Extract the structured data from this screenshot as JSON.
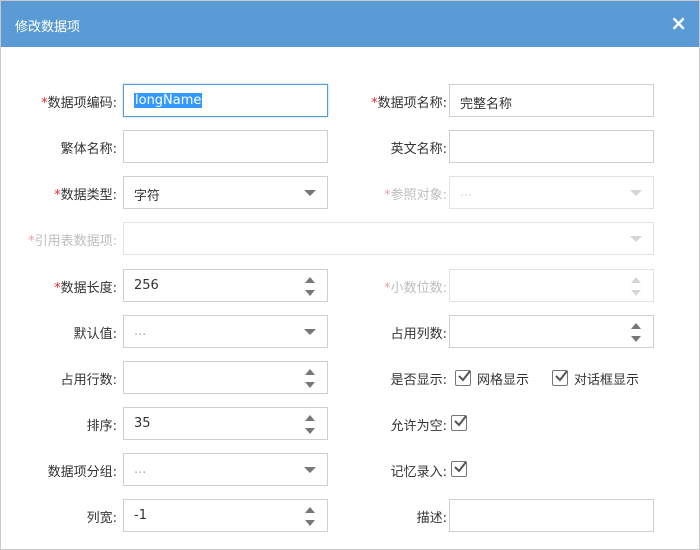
{
  "dialog": {
    "title": "修改数据项",
    "close_icon": "×"
  },
  "labels": {
    "code": "数据项编码:",
    "name": "数据项名称:",
    "trad_name": "繁体名称:",
    "en_name": "英文名称:",
    "data_type": "数据类型:",
    "ref_obj": "参照对象:",
    "ref_table": "引用表数据项:",
    "length": "数据长度:",
    "decimals": "小数位数:",
    "default": "默认值:",
    "col_span": "占用列数:",
    "row_span": "占用行数:",
    "visible": "是否显示:",
    "order": "排序:",
    "nullable": "允许为空:",
    "group": "数据项分组:",
    "remember": "记忆录入:",
    "col_width": "列宽:",
    "desc": "描述:"
  },
  "required_mark": "*",
  "values": {
    "code": "longName",
    "name": "完整名称",
    "trad_name": "",
    "en_name": "",
    "data_type": "字符",
    "ref_obj_placeholder": "...",
    "ref_table": "",
    "length": "256",
    "decimals": "",
    "default_placeholder": "...",
    "col_span": "",
    "row_span": "",
    "order": "35",
    "group_placeholder": "...",
    "col_width": "-1",
    "desc": ""
  },
  "checkboxes": {
    "grid_display": {
      "label": "网格显示",
      "checked": true
    },
    "dialog_display": {
      "label": "对话框显示",
      "checked": true
    },
    "nullable": {
      "checked": true
    },
    "remember": {
      "checked": true
    }
  },
  "colors": {
    "title_bar": "#5b9bd5",
    "required": "#e52727",
    "focus_border": "#5b9bd5"
  }
}
